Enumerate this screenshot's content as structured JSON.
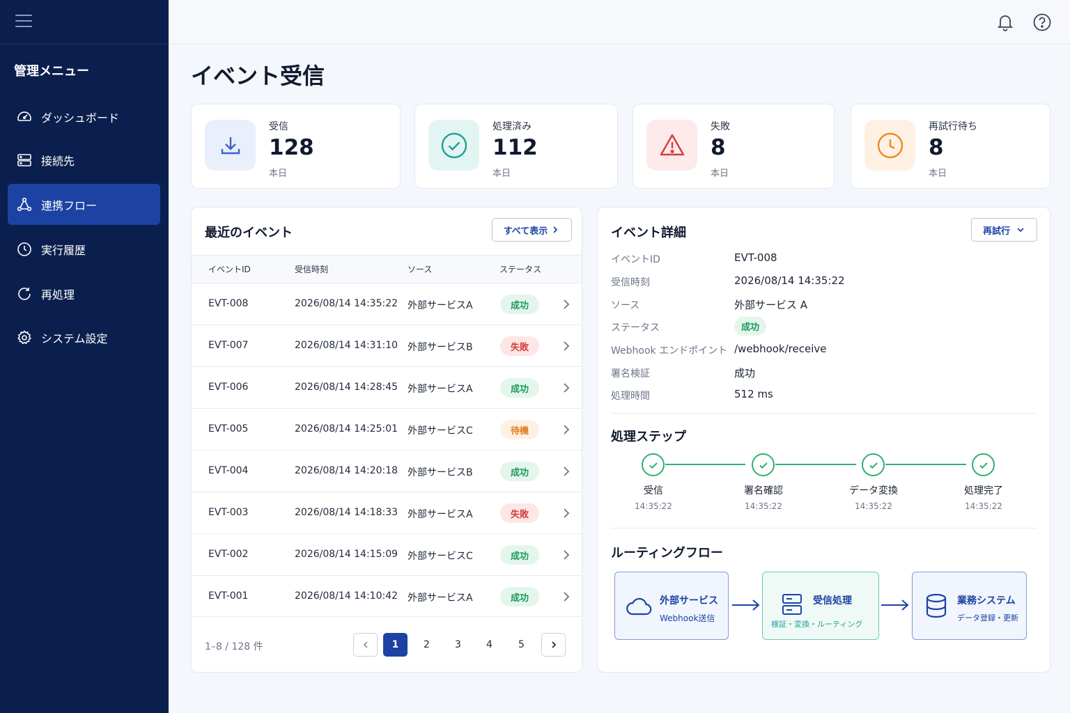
{
  "sidebar": {
    "title": "管理メニュー",
    "items": [
      {
        "label": "ダッシュボード"
      },
      {
        "label": "接続先"
      },
      {
        "label": "連携フロー"
      },
      {
        "label": "実行履歴"
      },
      {
        "label": "再処理"
      },
      {
        "label": "システム設定"
      }
    ]
  },
  "page": {
    "title": "イベント受信"
  },
  "stats": [
    {
      "label": "受信",
      "value": "128",
      "sub": "本日",
      "icon": "download-icon",
      "color": "#3b63c9"
    },
    {
      "label": "処理済み",
      "value": "112",
      "sub": "本日",
      "icon": "check-circle-icon",
      "color": "#1f9f95"
    },
    {
      "label": "失敗",
      "value": "8",
      "sub": "本日",
      "icon": "warning-icon",
      "color": "#d93a3a"
    },
    {
      "label": "再試行待ち",
      "value": "8",
      "sub": "本日",
      "icon": "clock-icon",
      "color": "#ea8a1f"
    }
  ],
  "events": {
    "title": "最近のイベント",
    "view_all": "すべて表示",
    "columns": [
      "イベントID",
      "受信時刻",
      "ソース",
      "ステータス"
    ],
    "rows": [
      {
        "id": "EVT-008",
        "time": "2026/08/14 14:35:22",
        "source": "外部サービスA",
        "status": "成功"
      },
      {
        "id": "EVT-007",
        "time": "2026/08/14 14:31:10",
        "source": "外部サービスB",
        "status": "失敗"
      },
      {
        "id": "EVT-006",
        "time": "2026/08/14 14:28:45",
        "source": "外部サービスA",
        "status": "成功"
      },
      {
        "id": "EVT-005",
        "time": "2026/08/14 14:25:01",
        "source": "外部サービスC",
        "status": "待機"
      },
      {
        "id": "EVT-004",
        "time": "2026/08/14 14:20:18",
        "source": "外部サービスB",
        "status": "成功"
      },
      {
        "id": "EVT-003",
        "time": "2026/08/14 14:18:33",
        "source": "外部サービスA",
        "status": "失敗"
      },
      {
        "id": "EVT-002",
        "time": "2026/08/14 14:15:09",
        "source": "外部サービスC",
        "status": "成功"
      },
      {
        "id": "EVT-001",
        "time": "2026/08/14 14:10:42",
        "source": "外部サービスA",
        "status": "成功"
      }
    ],
    "pager": {
      "info": "1–8 / 128 件",
      "pages": [
        "1",
        "2",
        "3",
        "4",
        "5"
      ],
      "current": "1"
    }
  },
  "detail": {
    "title": "イベント詳細",
    "retry": "再試行",
    "fields": [
      {
        "label": "イベントID",
        "value": "EVT-008"
      },
      {
        "label": "受信時刻",
        "value": "2026/08/14 14:35:22"
      },
      {
        "label": "ソース",
        "value": "外部サービス A"
      },
      {
        "label": "ステータス",
        "value": "成功"
      },
      {
        "label": "Webhook エンドポイント",
        "value": "/webhook/receive"
      },
      {
        "label": "署名検証",
        "value": "成功"
      },
      {
        "label": "処理時間",
        "value": "512 ms"
      }
    ],
    "steps_title": "処理ステップ",
    "steps": [
      {
        "label": "受信",
        "time": "14:35:22"
      },
      {
        "label": "署名確認",
        "time": "14:35:22"
      },
      {
        "label": "データ変換",
        "time": "14:35:22"
      },
      {
        "label": "処理完了",
        "time": "14:35:22"
      }
    ],
    "routing_title": "ルーティングフロー",
    "routing": [
      {
        "title": "外部サービス",
        "sub": "Webhook送信",
        "icon": "cloud-icon"
      },
      {
        "title": "受信処理",
        "sub": "検証・変換・ルーティング",
        "icon": "server-icon"
      },
      {
        "title": "業務システム",
        "sub": "データ登録・更新",
        "icon": "database-icon"
      }
    ]
  },
  "status_colors": {
    "成功": {
      "bg": "#e4f6ec",
      "fg": "#1f9a5c"
    },
    "失敗": {
      "bg": "#fde6e6",
      "fg": "#d63b3b"
    },
    "待機": {
      "bg": "#fff1e2",
      "fg": "#e07c1c"
    }
  }
}
